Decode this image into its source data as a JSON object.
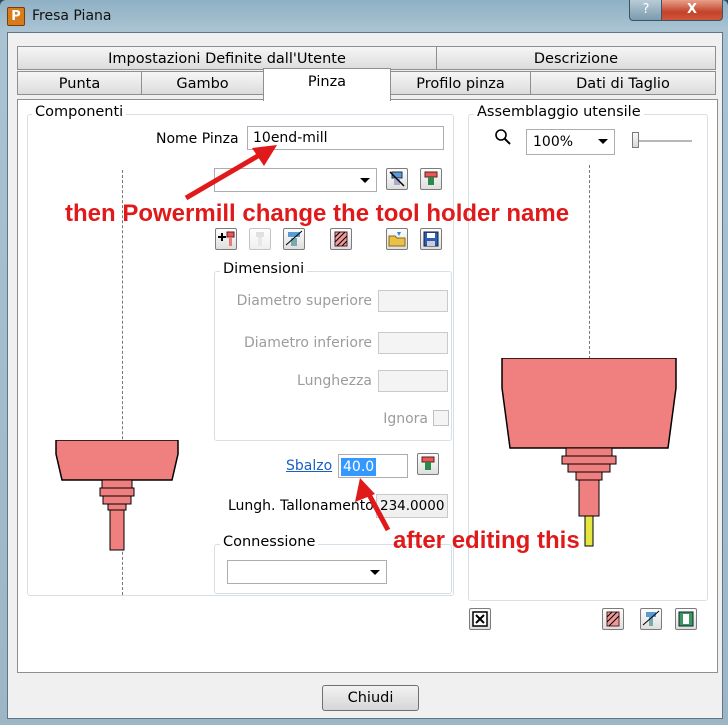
{
  "window": {
    "title": "Fresa Piana",
    "help_label": "?",
    "close_label": "X",
    "app_icon": "P"
  },
  "tabs": {
    "row1": [
      "Impostazioni Definite dall'Utente",
      "Descrizione"
    ],
    "row2": [
      "Punta",
      "Gambo",
      "Pinza",
      "Profilo pinza",
      "Dati di Taglio"
    ],
    "selected": "Pinza"
  },
  "componenti": {
    "legend": "Componenti",
    "nome_pinza_label": "Nome Pinza",
    "nome_pinza_value": "10end-mill",
    "dimensioni": {
      "legend": "Dimensioni",
      "diametro_superiore": "Diametro superiore",
      "diametro_inferiore": "Diametro inferiore",
      "lunghezza": "Lunghezza",
      "ignora": "Ignora"
    },
    "sbalzo_label": "Sbalzo",
    "sbalzo_value": "40.0",
    "lungh_label": "Lungh. Tallonamento",
    "lungh_value": "234.0000",
    "connessione_legend": "Connessione"
  },
  "assemblaggio": {
    "legend": "Assemblaggio utensile",
    "zoom": "100%",
    "zoom_slider": 0
  },
  "annotations": {
    "top": "then Powermill change the tool holder name",
    "bottom": "after editing this",
    "color": "#e0191a"
  },
  "holder_color": "#f08080",
  "footer": {
    "close_button": "Chiudi"
  }
}
